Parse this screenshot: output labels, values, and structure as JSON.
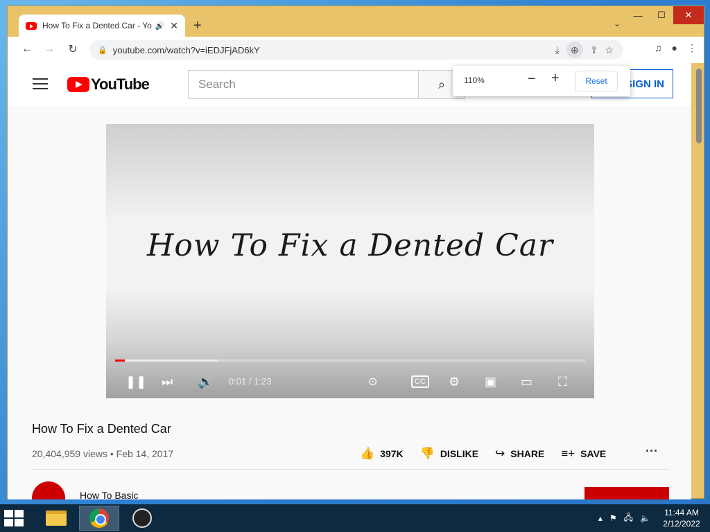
{
  "browser": {
    "tab_title": "How To Fix a Dented Car - Yo",
    "url": "youtube.com/watch?v=iEDJFjAD6kY"
  },
  "youtube": {
    "logo_text": "YouTube",
    "search_placeholder": "Search",
    "signin_label": "SIGN IN",
    "video": {
      "frame_title": "How To Fix a Dented Car",
      "time": "0:01 / 1:23",
      "played_fraction": 0.012,
      "buffered_fraction": 0.22,
      "title": "How To Fix a Dented Car",
      "meta": "20,404,959 views • Feb 14, 2017"
    },
    "actions": {
      "like_count": "397K",
      "dislike_label": "DISLIKE",
      "share_label": "SHARE",
      "save_label": "SAVE"
    },
    "channel_name": "How To Basic"
  },
  "zoom_popup": {
    "level": "110%",
    "minus": "−",
    "plus": "+",
    "reset_label": "Reset"
  },
  "taskbar": {
    "time": "11:44 AM",
    "date": "2/12/2022"
  },
  "colors": {
    "titlebar": "#e8c36a",
    "youtube_red": "#ff0000",
    "signin_blue": "#065fd4",
    "taskbar": "#0e2a40"
  }
}
